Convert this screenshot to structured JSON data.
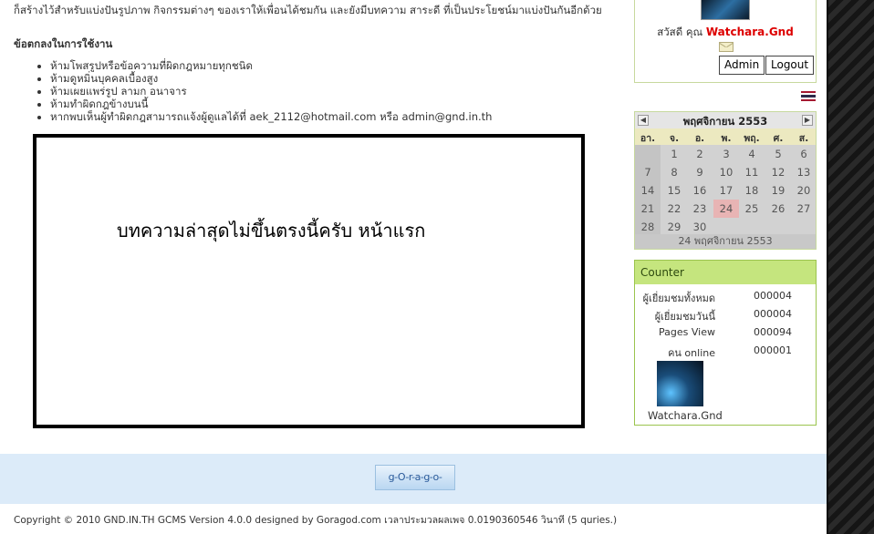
{
  "main": {
    "intro": "ก็สร้างไว้สำหรับแบ่งปันรูปภาพ กิจกรรมต่างๆ ของเราให้เพื่อนได้ชมกัน และยังมีบทความ สาระดี ที่เป็นประโยชน์มาแบ่งปันกันอีกด้วย",
    "rules_heading": "ข้อตกลงในการใช้งาน",
    "rules": [
      "ห้ามโพสรูปหรือข้อความที่ผิดกฎหมายทุกชนิด",
      "ห้ามดูหมิ่นบุคคลเบื้องสูง",
      "ห้ามเผยแพร่รูป ลามก อนาจาร",
      "ห้ามทำผิดกฎข้างบนนี้",
      "หากพบเห็นผู้ทำผิดกฎสามารถแจ้งผู้ดูแลได้ที่ aek_2112@hotmail.com หรือ admin@gnd.in.th"
    ],
    "notice_text": "บทความล่าสุดไม่ขึ้นตรงนี้ครับ   หน้าแรก"
  },
  "user": {
    "greeting": "สวัสดี คุณ",
    "name": "Watchara.Gnd",
    "admin_label": "Admin",
    "logout_label": "Logout"
  },
  "calendar": {
    "title": "พฤศจิกายน 2553",
    "prev_icon": "prev-month-icon",
    "next_icon": "next-month-icon",
    "weekdays": [
      "อา.",
      "จ.",
      "อ.",
      "พ.",
      "พฤ.",
      "ศ.",
      "ส."
    ],
    "weeks": [
      [
        "",
        "1",
        "2",
        "3",
        "4",
        "5",
        "6"
      ],
      [
        "7",
        "8",
        "9",
        "10",
        "11",
        "12",
        "13"
      ],
      [
        "14",
        "15",
        "16",
        "17",
        "18",
        "19",
        "20"
      ],
      [
        "21",
        "22",
        "23",
        "24",
        "25",
        "26",
        "27"
      ],
      [
        "28",
        "29",
        "30",
        "",
        "",
        "",
        ""
      ]
    ],
    "today": "24",
    "footer": "24 พฤศจิกายน 2553"
  },
  "counter": {
    "title": "Counter",
    "rows": [
      {
        "label": "ผู้เยี่ยมชมทั้งหมด",
        "value": "000004"
      },
      {
        "label": "ผู้เยี่ยมชมวันนี้",
        "value": "000004"
      },
      {
        "label": "Pages View",
        "value": "000094"
      },
      {
        "label": "คน online",
        "value": "000001"
      }
    ],
    "online_user": "Watchara.Gnd"
  },
  "footer": {
    "logo_text": "g-O-r-a-g-o-d.com",
    "copyright": "Copyright © 2010 GND.IN.TH GCMS Version 4.0.0 designed by Goragod.com เวลาประมวลผลเพจ 0.0190360546 วินาที (5 quries.)"
  },
  "colors": {
    "counter_header": "#c5e57e",
    "username": "#dd0000",
    "footer_band": "#dcebf9"
  }
}
